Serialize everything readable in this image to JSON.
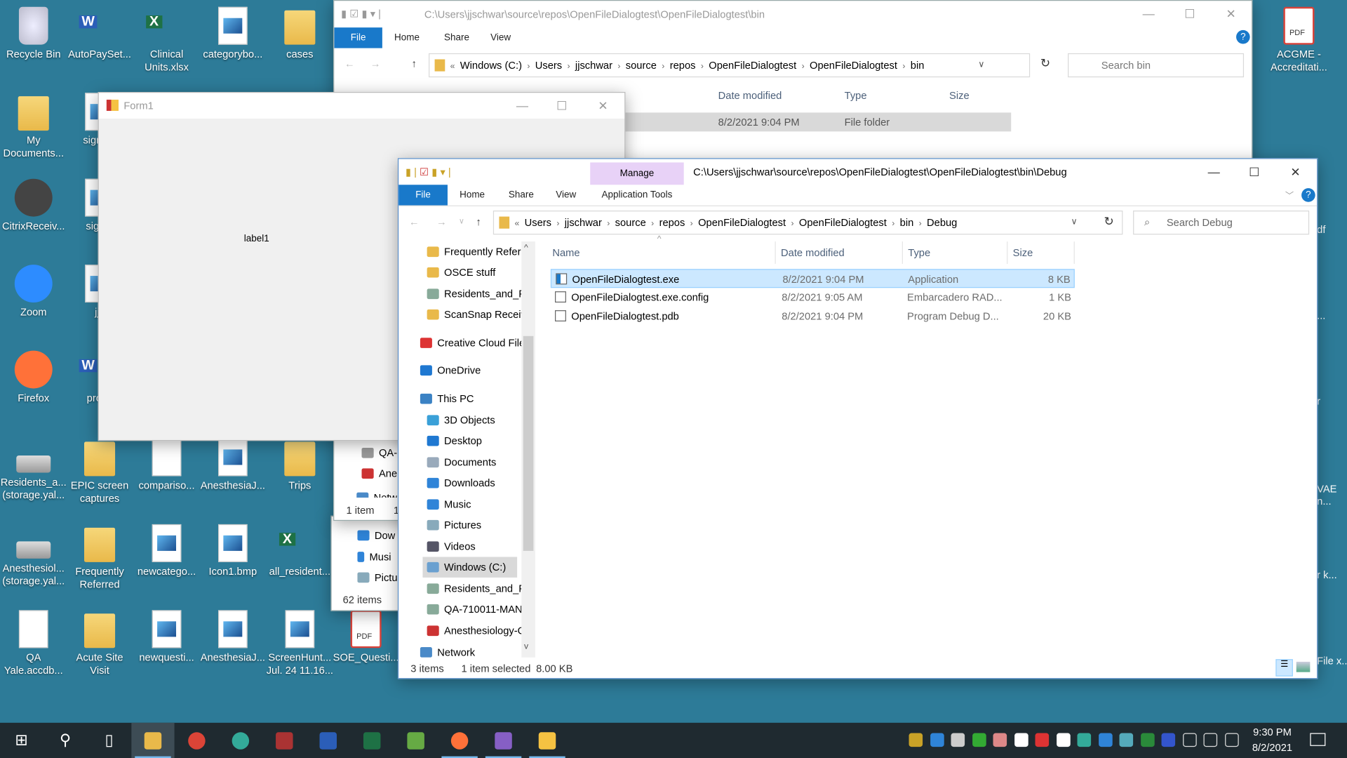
{
  "desktop": {
    "background": "#2d7b98",
    "icons": [
      {
        "label": "Recycle Bin",
        "type": "recycle"
      },
      {
        "label": "AutoPaySet...",
        "type": "word"
      },
      {
        "label": "Clinical Units.xlsx",
        "type": "excel"
      },
      {
        "label": "categorybo...",
        "type": "image"
      },
      {
        "label": "cases",
        "type": "folder"
      },
      {
        "label": "My Documents...",
        "type": "folder"
      },
      {
        "label": "signatu",
        "type": "image"
      },
      {
        "label": "CitrixReceiv...",
        "type": "app"
      },
      {
        "label": "signat",
        "type": "image"
      },
      {
        "label": "Zoom",
        "type": "app"
      },
      {
        "label": "jjs",
        "type": "image"
      },
      {
        "label": "Firefox",
        "type": "app"
      },
      {
        "label": "prof_l",
        "type": "word"
      },
      {
        "label": "Residents_a... (storage.yal...",
        "type": "drive"
      },
      {
        "label": "EPIC screen captures",
        "type": "folder"
      },
      {
        "label": "compariso...",
        "type": "doc"
      },
      {
        "label": "AnesthesiaJ...",
        "type": "image"
      },
      {
        "label": "Trips",
        "type": "folder"
      },
      {
        "label": "Anesthesiol... (storage.yal...",
        "type": "drive"
      },
      {
        "label": "Frequently Referred",
        "type": "folder"
      },
      {
        "label": "newcatego...",
        "type": "image"
      },
      {
        "label": "Icon1.bmp",
        "type": "image"
      },
      {
        "label": "all_resident...",
        "type": "excel"
      },
      {
        "label": "QA Yale.accdb...",
        "type": "doc"
      },
      {
        "label": "Acute Site Visit",
        "type": "folder"
      },
      {
        "label": "newquesti...",
        "type": "image"
      },
      {
        "label": "AnesthesiaJ...",
        "type": "image"
      },
      {
        "label": "ScreenHunt... Jul. 24 11.16...",
        "type": "image"
      },
      {
        "label": "SOE_Questi...",
        "type": "pdf"
      },
      {
        "label": "ACGME - Accreditati...",
        "type": "pdf"
      }
    ],
    "clipped_labels": [
      "df",
      "...",
      "r",
      "VAE n...",
      "r k...",
      "File x..."
    ]
  },
  "back_explorer": {
    "title": "C:\\Users\\jjschwar\\source\\repos\\OpenFileDialogtest\\OpenFileDialogtest\\bin",
    "tabs": [
      "File",
      "Home",
      "Share",
      "View"
    ],
    "breadcrumb": [
      "Windows (C:)",
      "Users",
      "jjschwar",
      "source",
      "repos",
      "OpenFileDialogtest",
      "OpenFileDialogtest",
      "bin"
    ],
    "search_placeholder": "Search bin",
    "columns": [
      "Date modified",
      "Type",
      "Size"
    ],
    "row": {
      "date": "8/2/2021 9:04 PM",
      "type": "File folder"
    },
    "nav": [
      "QA-",
      "Ane",
      "Netw"
    ],
    "status": "1 item",
    "status2": "1"
  },
  "third_window": {
    "nav": [
      "Dow",
      "Musi",
      "Pictu"
    ],
    "status": "62 items"
  },
  "form1": {
    "title": "Form1",
    "label": "label1"
  },
  "explorer": {
    "title": "C:\\Users\\jjschwar\\source\\repos\\OpenFileDialogtest\\OpenFileDialogtest\\bin\\Debug",
    "context_tab": "Manage",
    "context_color": "#e8d2f7",
    "tabs": [
      "File",
      "Home",
      "Share",
      "View",
      "Application Tools"
    ],
    "breadcrumb": [
      "Users",
      "jjschwar",
      "source",
      "repos",
      "OpenFileDialogtest",
      "OpenFileDialogtest",
      "bin",
      "Debug"
    ],
    "search_placeholder": "Search Debug",
    "nav": [
      {
        "label": "Frequently Refer",
        "icon": "folder-icon"
      },
      {
        "label": "OSCE stuff",
        "icon": "folder-icon"
      },
      {
        "label": "Residents_and_Fe",
        "icon": "network-drive-icon"
      },
      {
        "label": "ScanSnap Receiv",
        "icon": "folder-icon"
      },
      {
        "label": "Creative Cloud File",
        "icon": "creative-cloud-icon"
      },
      {
        "label": "OneDrive",
        "icon": "onedrive-icon"
      },
      {
        "label": "This PC",
        "icon": "pc-icon"
      },
      {
        "label": "3D Objects",
        "icon": "3d-objects-icon"
      },
      {
        "label": "Desktop",
        "icon": "desktop-icon"
      },
      {
        "label": "Documents",
        "icon": "documents-icon"
      },
      {
        "label": "Downloads",
        "icon": "downloads-icon"
      },
      {
        "label": "Music",
        "icon": "music-icon"
      },
      {
        "label": "Pictures",
        "icon": "pictures-icon"
      },
      {
        "label": "Videos",
        "icon": "videos-icon"
      },
      {
        "label": "Windows (C:)",
        "icon": "drive-icon"
      },
      {
        "label": "Residents_and_Fe",
        "icon": "network-drive-icon"
      },
      {
        "label": "QA-710011-MAN",
        "icon": "network-drive-icon"
      },
      {
        "label": "Anesthesiology-G",
        "icon": "disconnected-drive-icon"
      },
      {
        "label": "Network",
        "icon": "network-icon"
      }
    ],
    "columns": [
      "Name",
      "Date modified",
      "Type",
      "Size"
    ],
    "files": [
      {
        "name": "OpenFileDialogtest.exe",
        "date": "8/2/2021 9:04 PM",
        "type": "Application",
        "size": "8 KB",
        "selected": true
      },
      {
        "name": "OpenFileDialogtest.exe.config",
        "date": "8/2/2021 9:05 AM",
        "type": "Embarcadero RAD...",
        "size": "1 KB",
        "selected": false
      },
      {
        "name": "OpenFileDialogtest.pdb",
        "date": "8/2/2021 9:04 PM",
        "type": "Program Debug D...",
        "size": "20 KB",
        "selected": false
      }
    ],
    "status": {
      "count": "3 items",
      "selection": "1 item selected",
      "size": "8.00 KB"
    }
  },
  "taskbar": {
    "apps": [
      "start",
      "search",
      "task-view",
      "file-explorer",
      "chrome",
      "globe",
      "calculator",
      "word",
      "excel",
      "photos",
      "firefox",
      "visual-studio",
      "form-app"
    ],
    "time": "9:30 PM",
    "date": "8/2/2021"
  }
}
